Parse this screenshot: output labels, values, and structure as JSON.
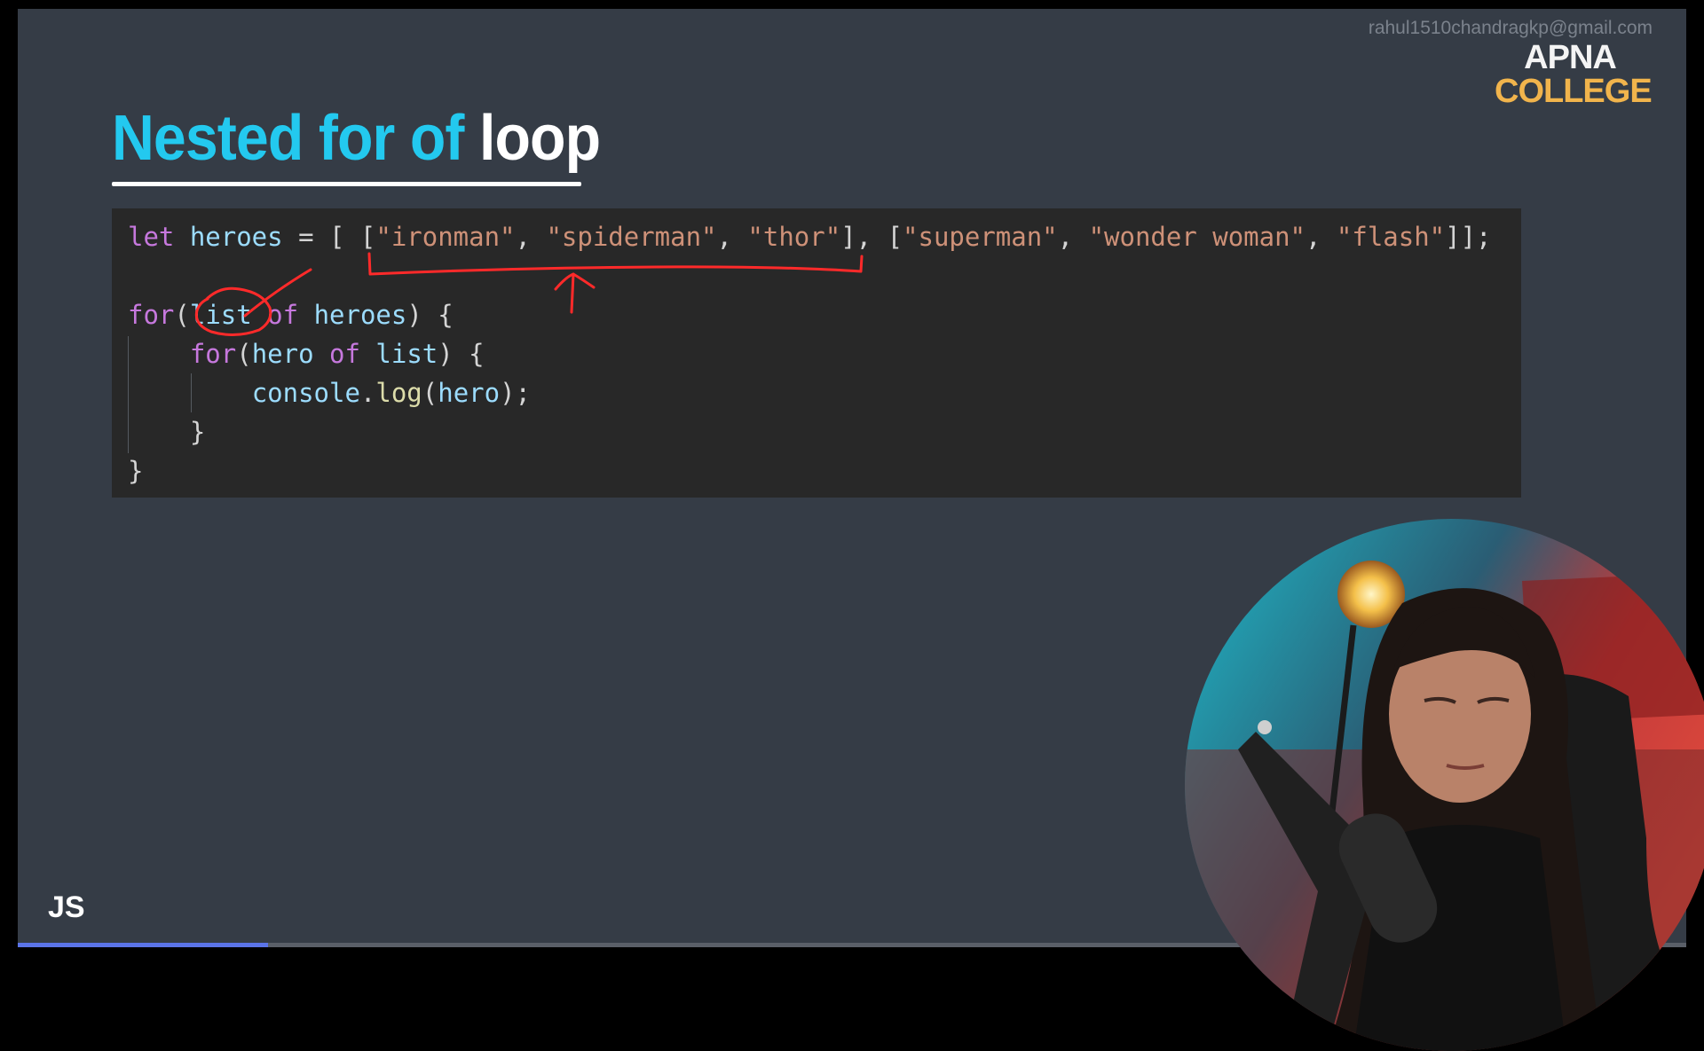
{
  "watermark": "rahul1510chandragkp@gmail.com",
  "logo": {
    "line1": "APNA",
    "line2": "COLLEGE"
  },
  "title": {
    "part1": "Nested for of ",
    "part2": "loop"
  },
  "code": {
    "line1": [
      {
        "t": "let ",
        "c": "kw"
      },
      {
        "t": "heroes",
        "c": "var"
      },
      {
        "t": " = [ [",
        "c": "pun"
      },
      {
        "t": "\"ironman\"",
        "c": "str"
      },
      {
        "t": ", ",
        "c": "pun"
      },
      {
        "t": "\"spiderman\"",
        "c": "str"
      },
      {
        "t": ", ",
        "c": "pun"
      },
      {
        "t": "\"thor\"",
        "c": "str"
      },
      {
        "t": "], [",
        "c": "pun"
      },
      {
        "t": "\"superman\"",
        "c": "str"
      },
      {
        "t": ", ",
        "c": "pun"
      },
      {
        "t": "\"wonder woman\"",
        "c": "str"
      },
      {
        "t": ", ",
        "c": "pun"
      },
      {
        "t": "\"flash\"",
        "c": "str"
      },
      {
        "t": "]];",
        "c": "pun"
      }
    ],
    "line2": [],
    "line3": [
      {
        "t": "for",
        "c": "kw"
      },
      {
        "t": "(",
        "c": "pun"
      },
      {
        "t": "list",
        "c": "var"
      },
      {
        "t": " ",
        "c": "pun"
      },
      {
        "t": "of",
        "c": "kw"
      },
      {
        "t": " ",
        "c": "pun"
      },
      {
        "t": "heroes",
        "c": "var"
      },
      {
        "t": ") {",
        "c": "pun"
      }
    ],
    "line4": [
      {
        "t": "    ",
        "c": "pun"
      },
      {
        "t": "for",
        "c": "kw"
      },
      {
        "t": "(",
        "c": "pun"
      },
      {
        "t": "hero",
        "c": "var"
      },
      {
        "t": " ",
        "c": "pun"
      },
      {
        "t": "of",
        "c": "kw"
      },
      {
        "t": " ",
        "c": "pun"
      },
      {
        "t": "list",
        "c": "var"
      },
      {
        "t": ") {",
        "c": "pun"
      }
    ],
    "line5": [
      {
        "t": "        ",
        "c": "pun"
      },
      {
        "t": "console",
        "c": "var"
      },
      {
        "t": ".",
        "c": "pun"
      },
      {
        "t": "log",
        "c": "fn"
      },
      {
        "t": "(",
        "c": "pun"
      },
      {
        "t": "hero",
        "c": "var"
      },
      {
        "t": ");",
        "c": "pun"
      }
    ],
    "line6": [
      {
        "t": "    }",
        "c": "pun"
      }
    ],
    "line7": [
      {
        "t": "}",
        "c": "pun"
      }
    ]
  },
  "badge": "JS",
  "progress": 0.15,
  "colors": {
    "slide_bg": "#353c46",
    "title_accent": "#23c9ef",
    "code_bg": "#282828",
    "annotation": "#ff2a2a",
    "logo_orange": "#f1b44c",
    "progress": "#5b74e8"
  }
}
